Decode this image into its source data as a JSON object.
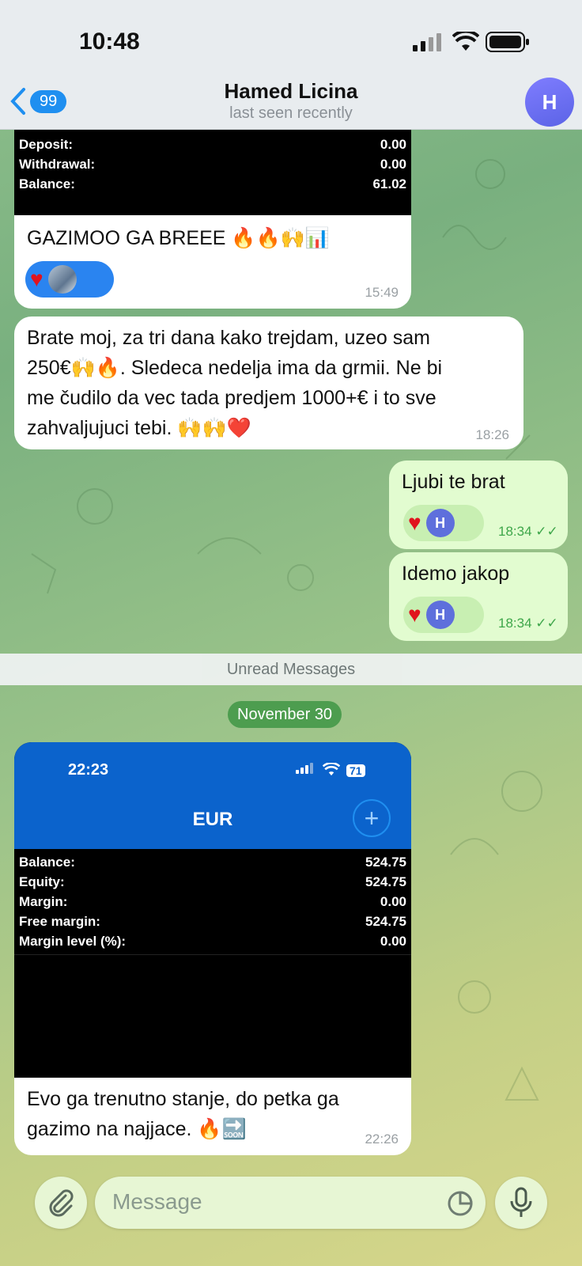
{
  "status": {
    "time": "10:48"
  },
  "header": {
    "back_count": "99",
    "name": "Hamed Licina",
    "status": "last seen recently",
    "avatar_letter": "H"
  },
  "messages": {
    "m1": {
      "report": [
        {
          "label": "Deposit:",
          "value": "0.00"
        },
        {
          "label": "Withdrawal:",
          "value": "0.00"
        },
        {
          "label": "Balance:",
          "value": "61.02"
        }
      ],
      "text": "GAZIMOO GA BREEE 🔥🔥🙌📊",
      "time": "15:49"
    },
    "m2": {
      "lines": [
        "Brate moj, za tri dana kako trejdam, uzeo sam",
        "250€🙌🔥. Sledeca nedelja ima da grmii. Ne bi",
        "me čudilo da vec tada predjem 1000+€ i to sve",
        "zahvaljujuci tebi. 🙌🙌❤️"
      ],
      "time": "18:26"
    },
    "m3": {
      "text": "Ljubi te brat",
      "time": "18:34",
      "reaction_letter": "H"
    },
    "m4": {
      "text": "Idemo jakop",
      "time": "18:34",
      "reaction_letter": "H"
    },
    "unread_label": "Unread Messages",
    "date_label": "November 30",
    "m5": {
      "screenshot": {
        "time": "22:23",
        "battery": "71",
        "currency": "EUR",
        "rows": [
          {
            "label": "Balance:",
            "value": "524.75"
          },
          {
            "label": "Equity:",
            "value": "524.75"
          },
          {
            "label": "Margin:",
            "value": "0.00"
          },
          {
            "label": "Free margin:",
            "value": "524.75"
          },
          {
            "label": "Margin level (%):",
            "value": "0.00"
          }
        ]
      },
      "lines": [
        "Evo ga trenutno stanje, do petka ga",
        "gazimo na najjace. 🔥🔜"
      ],
      "time": "22:26"
    }
  },
  "input": {
    "placeholder": "Message"
  }
}
